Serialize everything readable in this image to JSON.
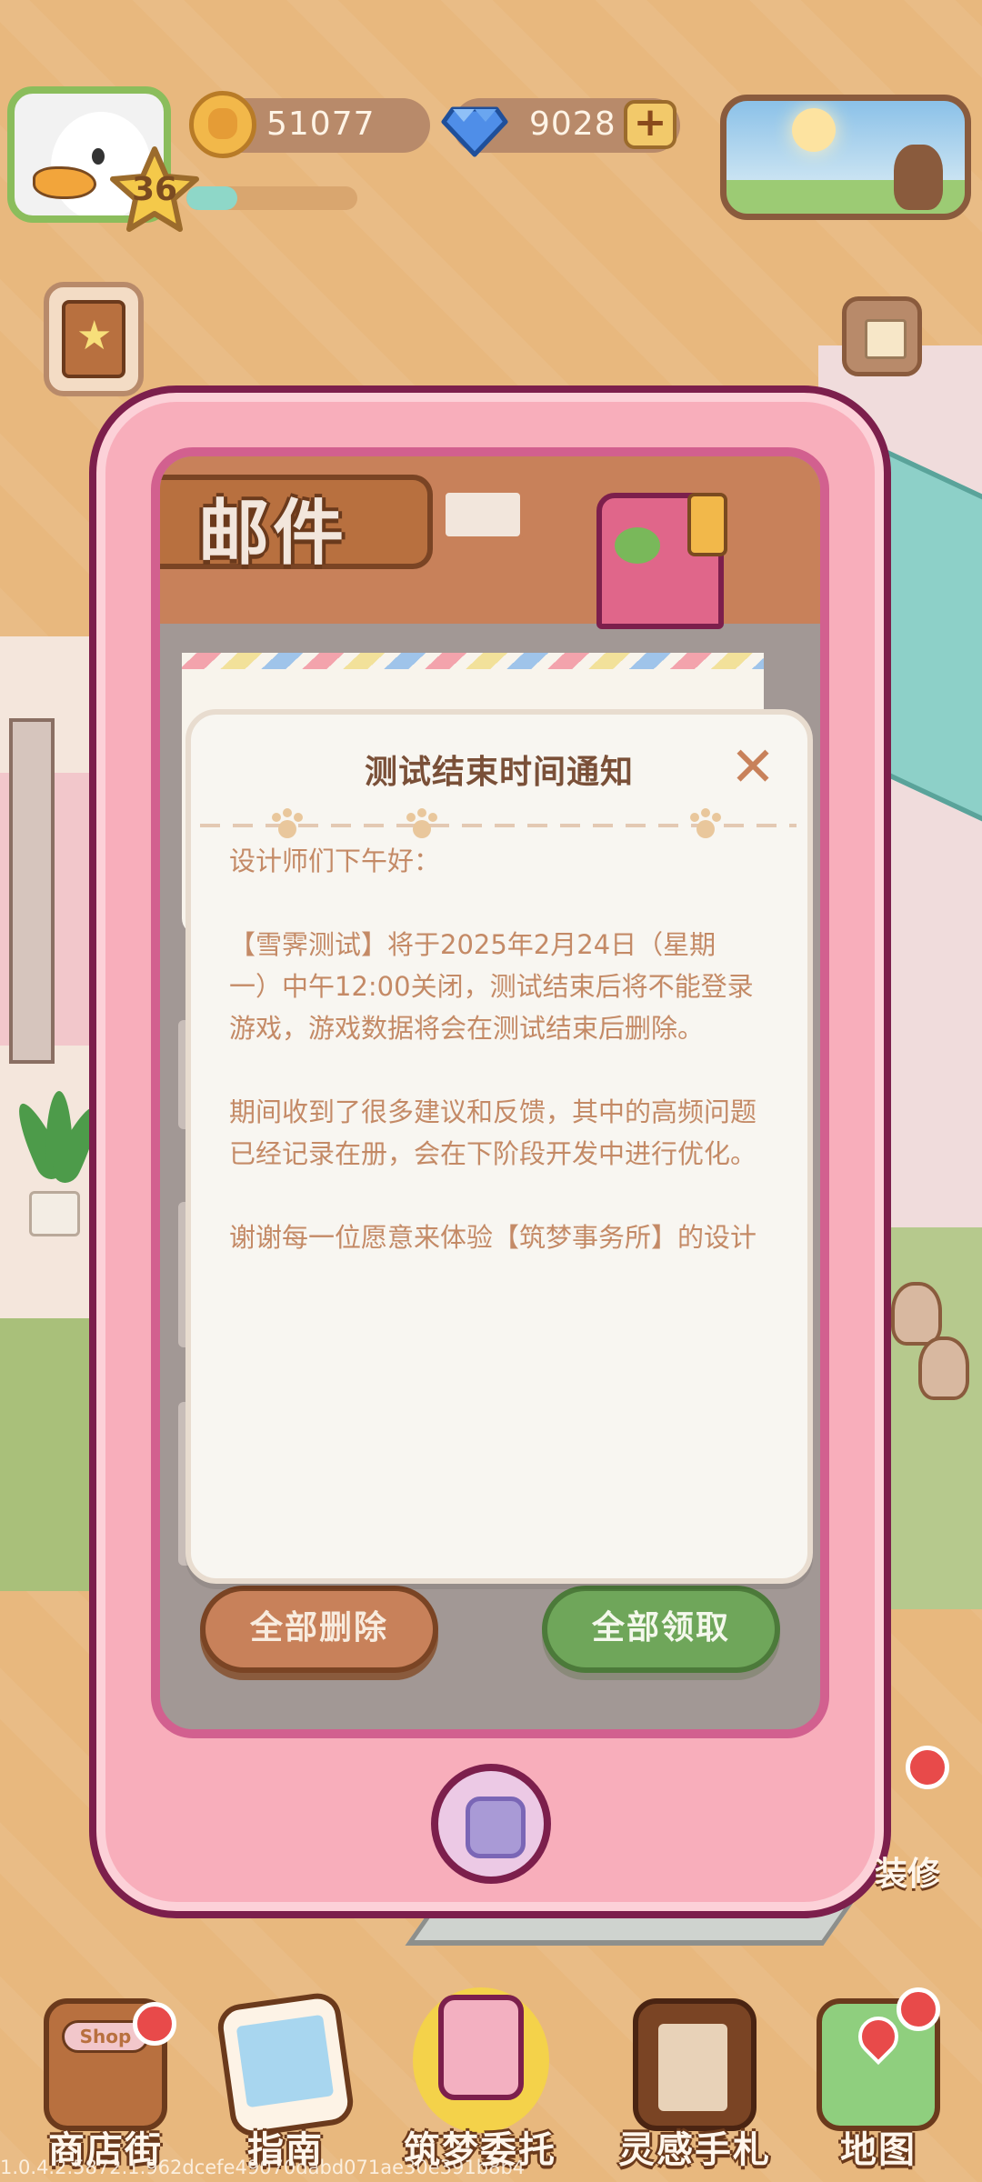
{
  "player": {
    "level": "36",
    "xp_progress": 0.3
  },
  "currency": {
    "coins": "51077",
    "gems": "9028",
    "plus_label": "+"
  },
  "mail": {
    "title": "邮件",
    "delete_all_label": "全部删除",
    "claim_all_label": "全部领取"
  },
  "notice": {
    "title": "测试结束时间通知",
    "close_glyph": "✕",
    "greeting": "设计师们下午好：",
    "paragraph1_line1": "【雪霁测试】将于2025年2月24日（星期",
    "paragraph1_line2": "一）中午12:00关闭，测试结束后将不能登录",
    "paragraph1_line3": "游戏，游戏数据将会在测试结束后删除。",
    "paragraph2_line1": "期间收到了很多建议和反馈，其中的高频问题",
    "paragraph2_line2": "已经记录在册，会在下阶段开发中进行优化。",
    "paragraph3_line1": "谢谢每一位愿意来体验【筑梦事务所】的设计"
  },
  "nav": {
    "items": [
      {
        "label": "商店街",
        "icon": "shop-icon",
        "badge": true
      },
      {
        "label": "指南",
        "icon": "guide-icon",
        "badge": false
      },
      {
        "label": "筑梦委托",
        "icon": "commission-icon",
        "badge": false
      },
      {
        "label": "灵感手札",
        "icon": "notes-icon",
        "badge": false
      },
      {
        "label": "地图",
        "icon": "map-icon",
        "badge": true
      }
    ]
  },
  "side": {
    "repair_label": "装修",
    "shop_sign": "Shop"
  },
  "build_version": "1.0.4.2.5872.1.962dcefe49070dabd071ae30e391b8b4",
  "colors": {
    "background": "#e8b87e",
    "phone_pink": "#f8aebb",
    "dialog_bg": "#f8f6f1",
    "body_text": "#c48a66",
    "title_text": "#7a5038",
    "claim_green": "#6fa65a",
    "delete_brown": "#c8815a",
    "badge_red": "#e84a4a"
  }
}
